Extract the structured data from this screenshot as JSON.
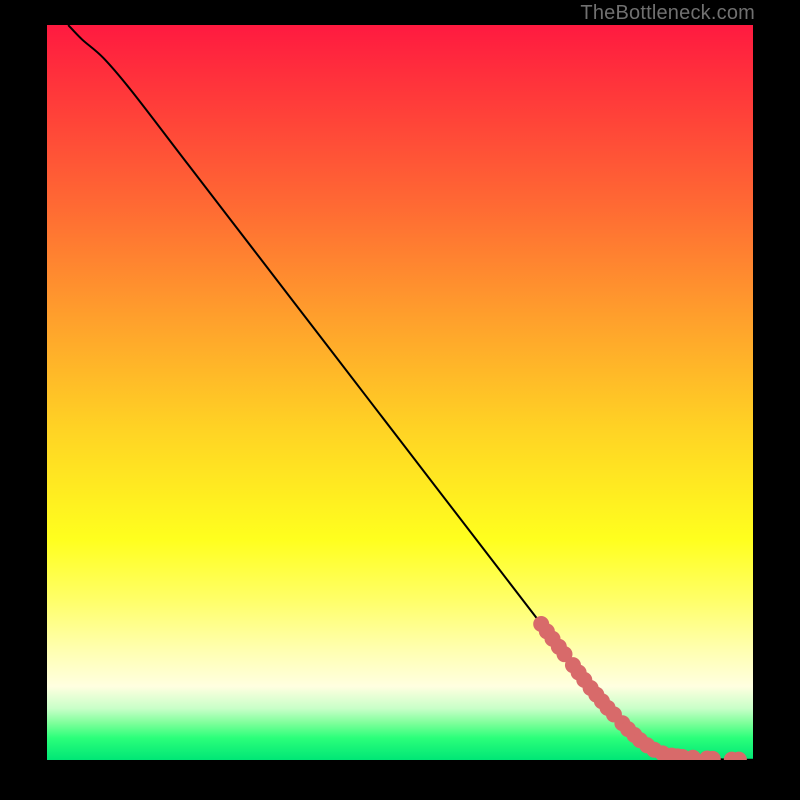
{
  "watermark": "TheBottleneck.com",
  "colors": {
    "curve": "#000000",
    "marker_fill": "#d86a6a",
    "marker_stroke": "#b44a4a",
    "background": "#000000"
  },
  "chart_data": {
    "type": "line",
    "title": "",
    "xlabel": "",
    "ylabel": "",
    "xlim": [
      0,
      100
    ],
    "ylim": [
      0,
      100
    ],
    "grid": false,
    "legend": false,
    "series": [
      {
        "name": "bottleneck-curve",
        "x": [
          3,
          5,
          8,
          12,
          20,
          30,
          40,
          50,
          60,
          70,
          76,
          80,
          83,
          85,
          87,
          89,
          91,
          93,
          95,
          97,
          100
        ],
        "y": [
          100,
          98,
          95.5,
          91,
          81,
          68.5,
          56,
          43.5,
          31,
          18.5,
          11,
          6.5,
          3.5,
          2,
          1,
          0.5,
          0.25,
          0.15,
          0.1,
          0.05,
          0.03
        ]
      }
    ],
    "markers": [
      {
        "x": 70.0,
        "y": 18.5
      },
      {
        "x": 70.8,
        "y": 17.5
      },
      {
        "x": 71.6,
        "y": 16.5
      },
      {
        "x": 72.5,
        "y": 15.4
      },
      {
        "x": 73.3,
        "y": 14.4
      },
      {
        "x": 74.5,
        "y": 12.9
      },
      {
        "x": 75.3,
        "y": 11.9
      },
      {
        "x": 76.1,
        "y": 10.9
      },
      {
        "x": 77.0,
        "y": 9.8
      },
      {
        "x": 77.8,
        "y": 8.9
      },
      {
        "x": 78.6,
        "y": 8.0
      },
      {
        "x": 79.4,
        "y": 7.1
      },
      {
        "x": 80.3,
        "y": 6.2
      },
      {
        "x": 81.5,
        "y": 5.0
      },
      {
        "x": 82.3,
        "y": 4.2
      },
      {
        "x": 83.2,
        "y": 3.4
      },
      {
        "x": 84.0,
        "y": 2.7
      },
      {
        "x": 85.0,
        "y": 2.0
      },
      {
        "x": 86.0,
        "y": 1.4
      },
      {
        "x": 87.2,
        "y": 0.9
      },
      {
        "x": 88.5,
        "y": 0.6
      },
      {
        "x": 89.3,
        "y": 0.5
      },
      {
        "x": 90.0,
        "y": 0.4
      },
      {
        "x": 91.5,
        "y": 0.3
      },
      {
        "x": 93.5,
        "y": 0.2
      },
      {
        "x": 94.3,
        "y": 0.15
      },
      {
        "x": 97.0,
        "y": 0.05
      },
      {
        "x": 98.0,
        "y": 0.05
      }
    ]
  }
}
